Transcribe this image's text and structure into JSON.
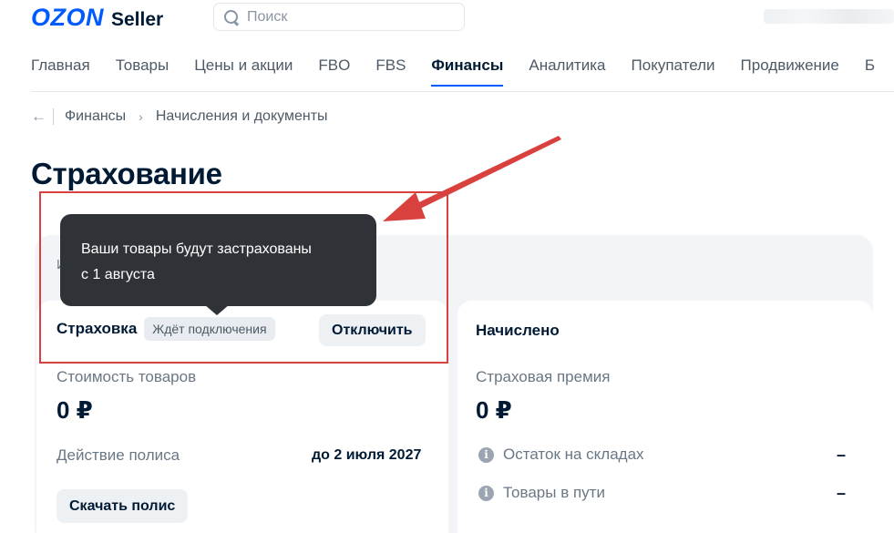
{
  "header": {
    "logo_brand": "OZON",
    "logo_suffix": "Seller",
    "search_placeholder": "Поиск"
  },
  "nav": {
    "items": [
      {
        "label": "Главная"
      },
      {
        "label": "Товары"
      },
      {
        "label": "Цены и акции"
      },
      {
        "label": "FBO"
      },
      {
        "label": "FBS"
      },
      {
        "label": "Финансы",
        "active": true
      },
      {
        "label": "Аналитика"
      },
      {
        "label": "Покупатели"
      },
      {
        "label": "Продвижение"
      },
      {
        "label": "Б"
      }
    ]
  },
  "breadcrumb": {
    "back_icon": "←",
    "items": [
      "Финансы",
      "Начисления и документы"
    ],
    "separator": "›"
  },
  "page_title": "Страхование",
  "panel_label": "И",
  "tooltip": {
    "line1": "Ваши товары будут застрахованы",
    "line2": "с 1 августа"
  },
  "insurance": {
    "label": "Страховка",
    "status_badge": "Ждёт подключения",
    "disable_button": "Отключить"
  },
  "left_card": {
    "goods_cost_label": "Стоимость товаров",
    "goods_cost_value": "0 ₽",
    "policy_label": "Действие полиса",
    "policy_value": "до 2 июля 2027",
    "download_button": "Скачать полис"
  },
  "right_card": {
    "title": "Начислено",
    "premium_label": "Страховая премия",
    "premium_value": "0 ₽",
    "rows": [
      {
        "label": "Остаток на складах",
        "value": "–"
      },
      {
        "label": "Товары в пути",
        "value": "–"
      }
    ],
    "info_icon_glyph": "i"
  },
  "colors": {
    "brand_blue": "#005bff",
    "annotation_red": "#d9413f",
    "tooltip_bg": "#2f3338"
  }
}
